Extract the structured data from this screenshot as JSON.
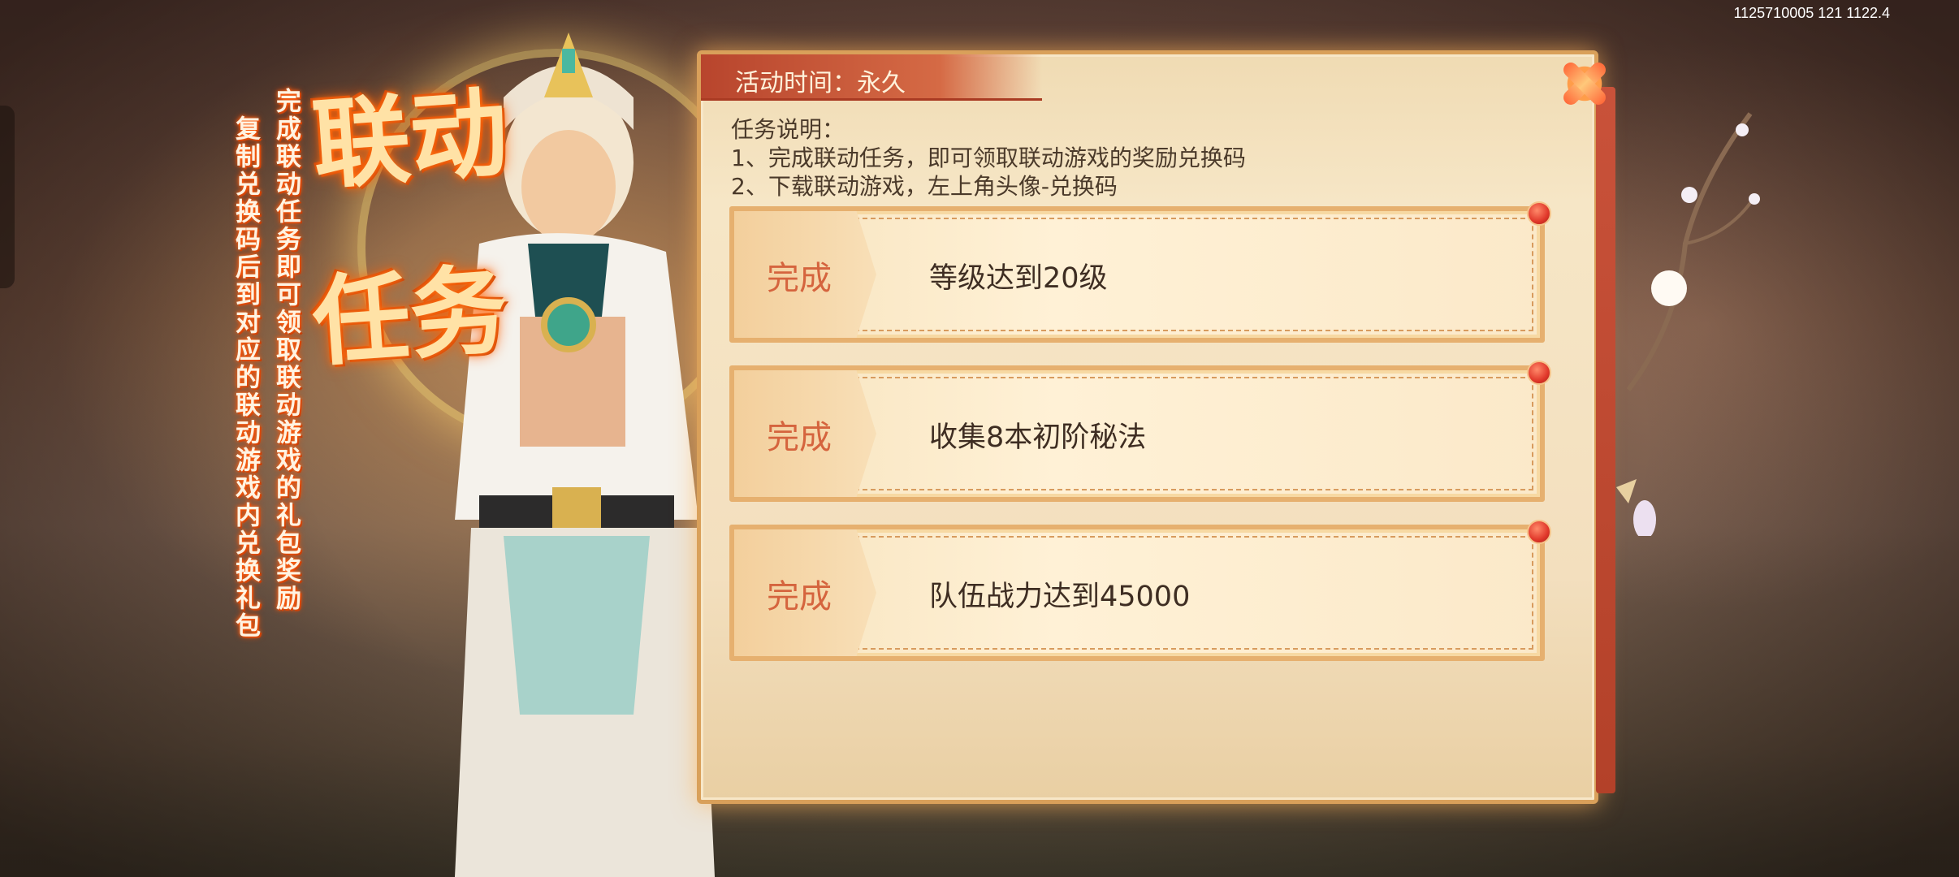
{
  "debug_info": "1125710005 121 1122.4",
  "banner": {
    "title_line1": "联动",
    "title_line2": "任务",
    "col1": "完成联动任务即可领取联动游戏的礼包奖励",
    "col2": "复制兑换码后到对应的联动游戏内兑换礼包"
  },
  "panel": {
    "header": "活动时间：永久",
    "desc": {
      "title": "任务说明：",
      "line1": "1、完成联动任务，即可领取联动游戏的奖励兑换码",
      "line2": "2、下载联动游戏，左上角头像-兑换码"
    },
    "tasks": [
      {
        "status": "完成",
        "text": "等级达到20级"
      },
      {
        "status": "完成",
        "text": "收集8本初阶秘法"
      },
      {
        "status": "完成",
        "text": "队伍战力达到45000"
      }
    ]
  },
  "colors": {
    "header_bg": "#c14e35",
    "complete_text": "#d5643e",
    "title_glow": "#ff7a1a"
  },
  "icons": [
    "star-icon",
    "red-dot-icon",
    "character-art",
    "plum-branch"
  ]
}
